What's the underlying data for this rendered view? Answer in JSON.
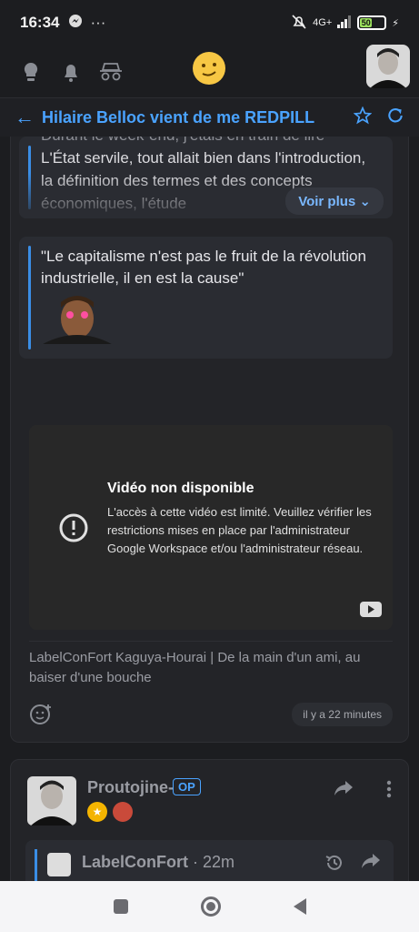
{
  "status": {
    "time": "16:34",
    "network": "4G+",
    "battery": "50"
  },
  "topbar": {
    "icons": [
      "lightbulb-icon",
      "bell-icon",
      "incognito-icon",
      "smirk-emoji-icon"
    ]
  },
  "topic": {
    "title": "Hilaire Belloc vient de me REDPILL"
  },
  "post1": {
    "quote_text": "L'État servile, tout allait bien dans l'introduction, la définition des termes et des concepts économiques, l'étude",
    "quote_top_partial": "Durant le week-end, j'étais en train de lire",
    "voir_plus": "Voir plus",
    "quote2_text": "\"Le capitalisme n'est pas le fruit de la révolution industrielle, il en est la cause\"",
    "video": {
      "title": "Vidéo non disponible",
      "description": "L'accès à cette vidéo est limité. Veuillez vérifier les restrictions mises en place par l'administrateur Google Workspace et/ou l'administrateur réseau."
    },
    "caption": "LabelConFort Kaguya-Hourai | De la main d'un ami, au baiser d'une bouche",
    "time": "il y a 22 minutes"
  },
  "post2": {
    "username": "Proutojine-",
    "op_badge": "OP",
    "reply_user": "LabelConFort",
    "reply_time": "· 22m"
  },
  "colors": {
    "accent": "#4aa3ff",
    "background": "#1c1d20",
    "card": "#232428"
  }
}
